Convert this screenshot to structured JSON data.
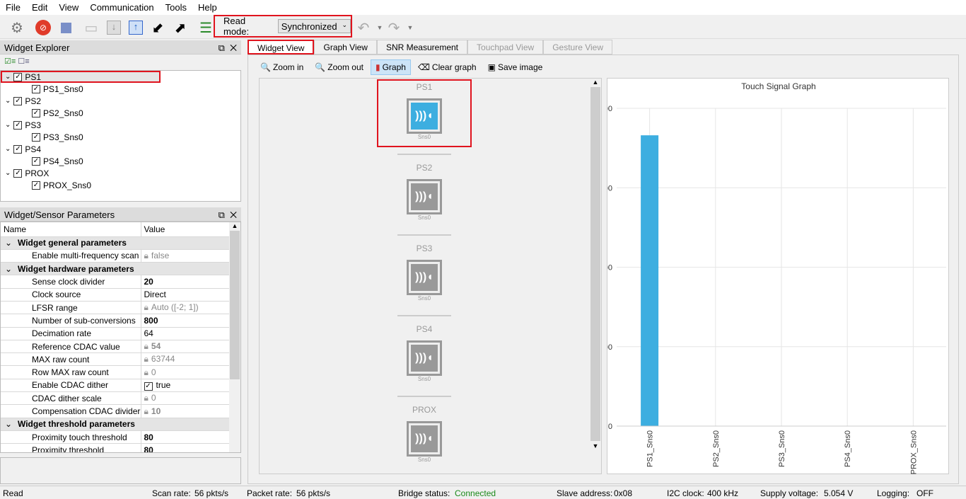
{
  "menu": [
    "File",
    "Edit",
    "View",
    "Communication",
    "Tools",
    "Help"
  ],
  "toolbar": {
    "read_mode_label": "Read mode:",
    "read_mode_value": "Synchronized"
  },
  "explorer": {
    "title": "Widget Explorer",
    "items": [
      {
        "label": "PS1",
        "child": "PS1_Sns0"
      },
      {
        "label": "PS2",
        "child": "PS2_Sns0"
      },
      {
        "label": "PS3",
        "child": "PS3_Sns0"
      },
      {
        "label": "PS4",
        "child": "PS4_Sns0"
      },
      {
        "label": "PROX",
        "child": "PROX_Sns0"
      }
    ]
  },
  "params": {
    "title": "Widget/Sensor Parameters",
    "col_name": "Name",
    "col_value": "Value",
    "rows": [
      {
        "g": "Widget general parameters"
      },
      {
        "n": "Enable multi-frequency scan",
        "v": "false",
        "lock": true
      },
      {
        "g": "Widget hardware parameters"
      },
      {
        "n": "Sense clock divider",
        "v": "20",
        "bold": true
      },
      {
        "n": "Clock source",
        "v": "Direct"
      },
      {
        "n": "LFSR range",
        "v": "Auto ([-2; 1])",
        "lock": true
      },
      {
        "n": "Number of sub-conversions",
        "v": "800",
        "bold": true
      },
      {
        "n": "Decimation rate",
        "v": "64"
      },
      {
        "n": "Reference CDAC value",
        "v": "54",
        "lock": true,
        "bold": true
      },
      {
        "n": "MAX raw count",
        "v": "63744",
        "lock": true
      },
      {
        "n": "Row MAX raw count",
        "v": "0",
        "lock": true
      },
      {
        "n": "Enable CDAC dither",
        "v": "true",
        "check": true
      },
      {
        "n": "CDAC dither scale",
        "v": "0",
        "lock": true
      },
      {
        "n": "Compensation CDAC divider",
        "v": "10",
        "lock": true,
        "bold": true
      },
      {
        "g": "Widget threshold parameters"
      },
      {
        "n": "Proximity touch threshold",
        "v": "80",
        "bold": true
      },
      {
        "n": "Proximity threshold",
        "v": "80",
        "bold": true
      }
    ]
  },
  "tabs": [
    {
      "label": "Widget View",
      "state": "active"
    },
    {
      "label": "Graph View"
    },
    {
      "label": "SNR Measurement"
    },
    {
      "label": "Touchpad View",
      "state": "disabled"
    },
    {
      "label": "Gesture View",
      "state": "disabled"
    }
  ],
  "view_toolbar": {
    "zoom_in": "Zoom in",
    "zoom_out": "Zoom out",
    "graph": "Graph",
    "clear_graph": "Clear graph",
    "save_image": "Save image"
  },
  "widgets": [
    {
      "name": "PS1",
      "sensor": "Sns0",
      "active": true
    },
    {
      "name": "PS2",
      "sensor": "Sns0"
    },
    {
      "name": "PS3",
      "sensor": "Sns0"
    },
    {
      "name": "PS4",
      "sensor": "Sns0"
    },
    {
      "name": "PROX",
      "sensor": "Sns0"
    }
  ],
  "accent": "#3daee0",
  "chart_data": {
    "type": "bar",
    "title": "Touch Signal Graph",
    "categories": [
      "PS1_Sns0",
      "PS2_Sns0",
      "PS3_Sns0",
      "PS4_Sns0",
      "PROX_Sns0"
    ],
    "values": [
      366,
      0,
      0,
      0,
      0
    ],
    "ylim": [
      0,
      400
    ],
    "yticks": [
      0,
      100,
      200,
      300,
      400
    ],
    "grid": true,
    "color": "#3daee0"
  },
  "status": {
    "read": "Read",
    "scan_rate_label": "Scan rate:",
    "scan_rate": "56 pkts/s",
    "packet_rate_label": "Packet rate:",
    "packet_rate": "56 pkts/s",
    "bridge_label": "Bridge status:",
    "bridge": "Connected",
    "slave_label": "Slave address:",
    "slave": "0x08",
    "i2c_label": "I2C clock:",
    "i2c": "400 kHz",
    "supply_label": "Supply voltage:",
    "supply": "5.054 V",
    "logging_label": "Logging:",
    "logging": "OFF"
  }
}
